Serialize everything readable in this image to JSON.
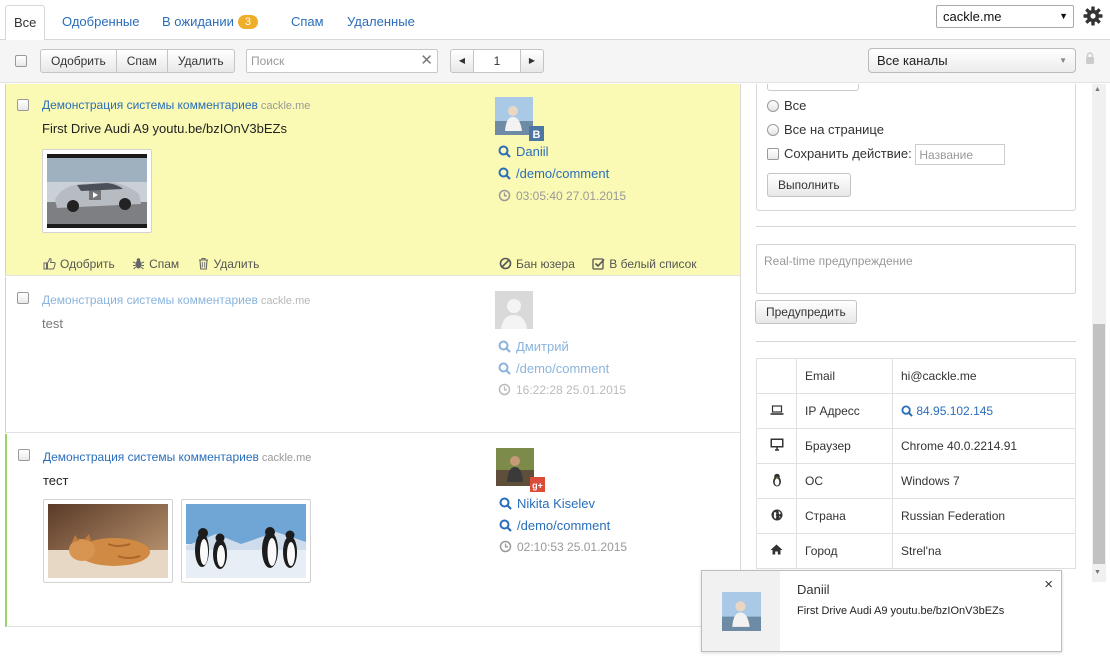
{
  "tabs": [
    {
      "label": "Все",
      "active": true
    },
    {
      "label": "Одобренные"
    },
    {
      "label": "В ожидании",
      "badge": "3"
    },
    {
      "label": "Спам"
    },
    {
      "label": "Удаленные"
    }
  ],
  "site_select": {
    "value": "cackle.me"
  },
  "toolbar": {
    "approve_label": "Одобрить",
    "spam_label": "Спам",
    "delete_label": "Удалить",
    "search_placeholder": "Поиск",
    "page": "1",
    "channels_label": "Все каналы"
  },
  "comments": [
    {
      "site": "Демонстрация системы комментариев",
      "domain": "cackle.me",
      "text": "First Drive Audi A9 youtu.be/bzIOnV3bEZs",
      "author": "Daniil",
      "network": "vk",
      "url": "/demo/comment",
      "time": "03:05:40 27.01.2015",
      "highlighted": true,
      "actions": {
        "approve": "Одобрить",
        "spam": "Спам",
        "delete": "Удалить",
        "ban": "Бан юзера",
        "whitelist": "В белый список"
      }
    },
    {
      "site": "Демонстрация системы комментариев",
      "domain": "cackle.me",
      "text": "test",
      "author": "Дмитрий",
      "url": "/demo/comment",
      "time": "16:22:28 25.01.2015"
    },
    {
      "site": "Демонстрация системы комментариев",
      "domain": "cackle.me",
      "text": "тест",
      "author": "Nikita Kiselev",
      "network": "google-plus",
      "url": "/demo/comment",
      "time": "02:10:53 25.01.2015"
    }
  ],
  "bulk": {
    "all": "Все",
    "all_on_page": "Все на странице",
    "save_action": "Сохранить действие:",
    "name_placeholder": "Название",
    "execute": "Выполнить"
  },
  "realtime": {
    "placeholder": "Real-time предупреждение",
    "button": "Предупредить"
  },
  "info": [
    {
      "icon": "envelope-icon",
      "key": "Email",
      "value": "hi@cackle.me"
    },
    {
      "icon": "laptop-icon",
      "key": "IP Адресс",
      "value": "84.95.102.145",
      "link": true
    },
    {
      "icon": "monitor-icon",
      "key": "Браузер",
      "value": "Chrome 40.0.2214.91"
    },
    {
      "icon": "linux-icon",
      "key": "ОС",
      "value": "Windows 7"
    },
    {
      "icon": "globe-icon",
      "key": "Страна",
      "value": "Russian Federation"
    },
    {
      "icon": "home-icon",
      "key": "Город",
      "value": "Strel'na"
    }
  ],
  "popup": {
    "name": "Daniil",
    "text": "First Drive Audi A9 youtu.be/bzIOnV3bEZs",
    "close": "×"
  },
  "colors": {
    "accent": "#2a6ebb",
    "highlight_bg": "#fafab4",
    "badge": "#f0ad2a",
    "approved_border": "#9ad26a"
  }
}
